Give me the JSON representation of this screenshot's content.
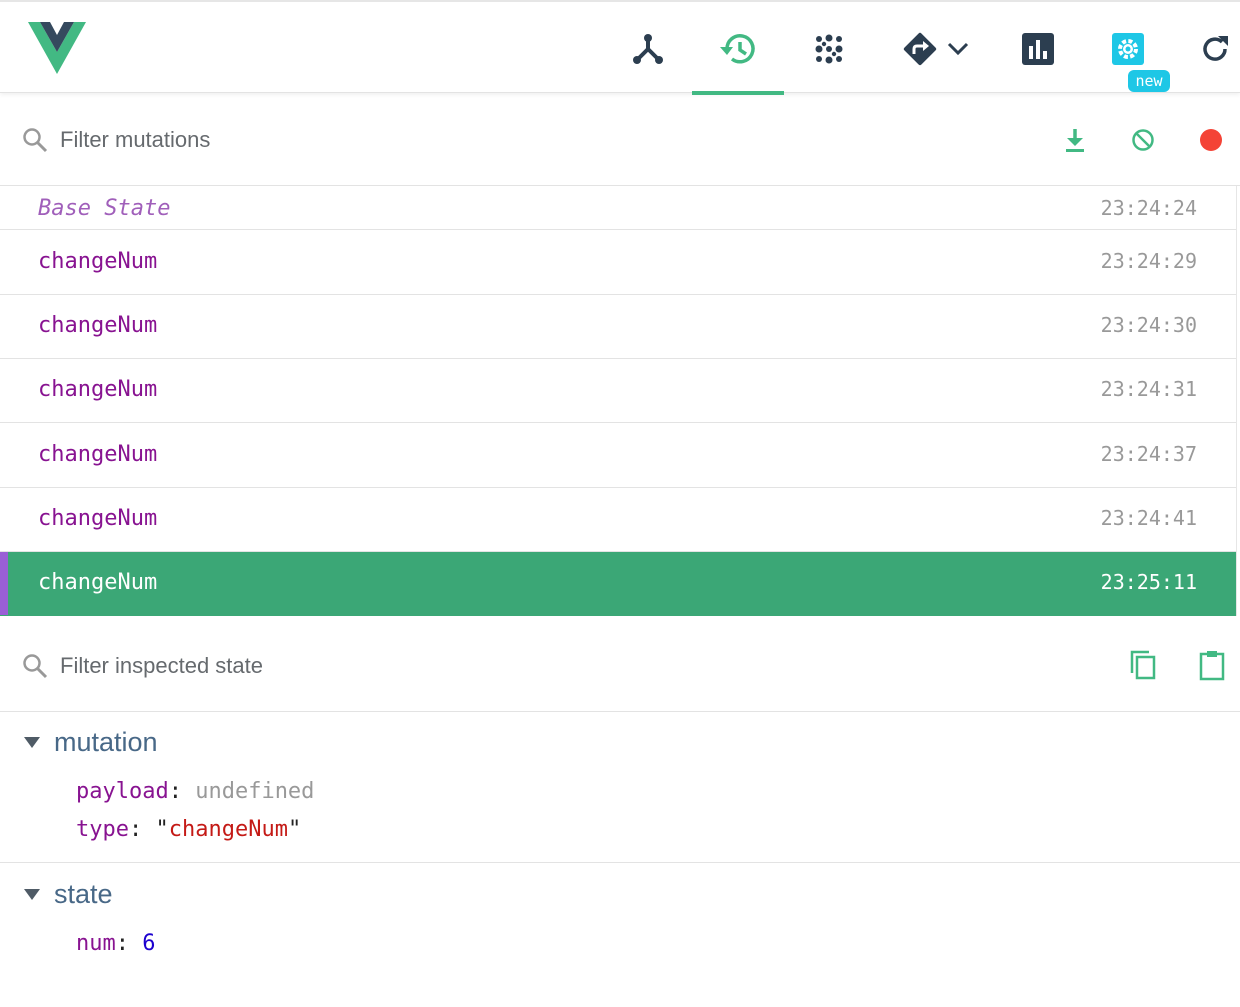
{
  "toolbar": {
    "badge_new": "new",
    "colors": {
      "accent": "#42b983",
      "icon": "#2c3e50",
      "badge": "#1ec7e6"
    },
    "tabs": [
      {
        "name": "components",
        "icon": "tree-icon",
        "active": false
      },
      {
        "name": "vuex",
        "icon": "history-icon",
        "active": true
      },
      {
        "name": "events",
        "icon": "dots-grid-icon",
        "active": false
      },
      {
        "name": "routing",
        "icon": "directions-icon",
        "active": false
      },
      {
        "name": "performance",
        "icon": "bar-chart-icon",
        "active": false
      },
      {
        "name": "settings",
        "icon": "gear-icon",
        "active": false
      },
      {
        "name": "refresh",
        "icon": "refresh-icon",
        "active": false
      }
    ]
  },
  "mutation_filter": {
    "placeholder": "Filter mutations",
    "actions": [
      "download-icon",
      "clear-icon",
      "record-icon"
    ],
    "record_color": "#f44336"
  },
  "mutations": [
    {
      "name": "Base State",
      "time": "23:24:24",
      "base": true
    },
    {
      "name": "changeNum",
      "time": "23:24:29"
    },
    {
      "name": "changeNum",
      "time": "23:24:30"
    },
    {
      "name": "changeNum",
      "time": "23:24:31"
    },
    {
      "name": "changeNum",
      "time": "23:24:37"
    },
    {
      "name": "changeNum",
      "time": "23:24:41"
    },
    {
      "name": "changeNum",
      "time": "23:25:11",
      "selected": true
    }
  ],
  "state_filter": {
    "placeholder": "Filter inspected state",
    "actions": [
      "copy-icon",
      "paste-icon"
    ]
  },
  "inspector": {
    "mutation": {
      "title": "mutation",
      "payload_key": "payload",
      "payload_value": "undefined",
      "type_key": "type",
      "type_value": "changeNum"
    },
    "state": {
      "title": "state",
      "num_key": "num",
      "num_value": "6"
    }
  }
}
